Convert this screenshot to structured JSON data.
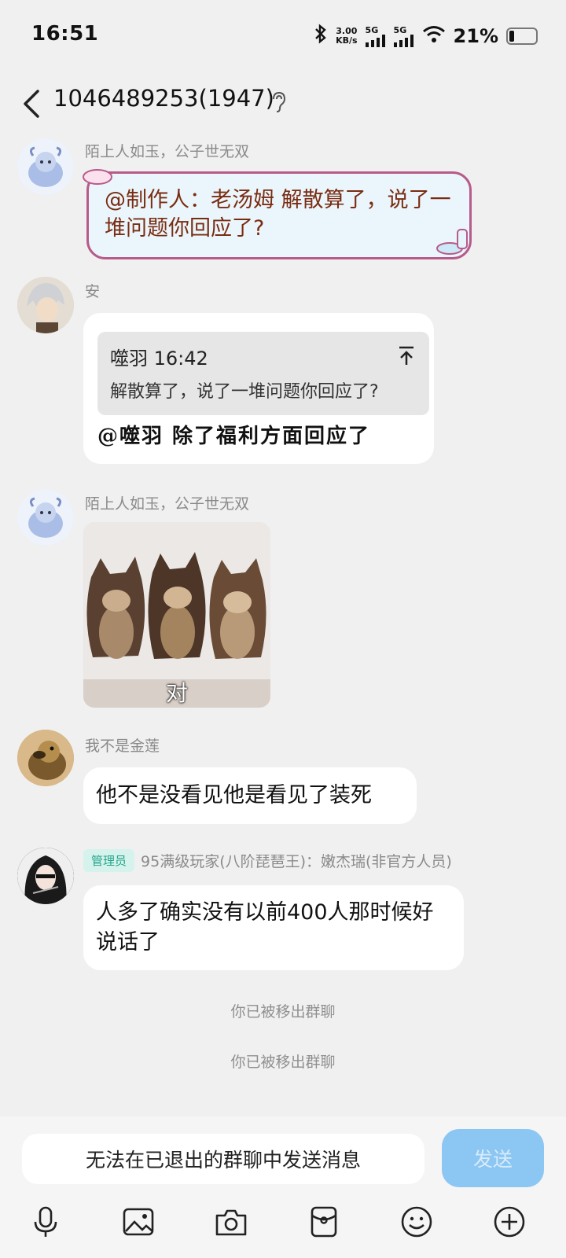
{
  "status": {
    "time": "16:51",
    "speed_value": "3.00",
    "speed_unit": "KB/s",
    "net1": "5G",
    "net2": "5G",
    "battery": "21%",
    "battery_level": 0.21
  },
  "header": {
    "title": "1046489253(1947)"
  },
  "messages": [
    {
      "sender": "陌上人如玉，公子世无双",
      "text": "@制作人：老汤姆 解散算了，说了一堆问题你回应了?"
    },
    {
      "sender": "安",
      "quote_author_time": "噬羽 16:42",
      "quote_text": "解散算了，说了一堆问题你回应了?",
      "text": "@噬羽 除了福利方面回应了"
    },
    {
      "sender": "陌上人如玉，公子世无双",
      "image_caption": "对"
    },
    {
      "sender": "我不是金莲",
      "text": "他不是没看见他是看见了装死"
    },
    {
      "badge": "管理员",
      "sender": "95满级玩家(八阶琵琶王)：嫩杰瑞(非官方人员)",
      "text": "人多了确实没有以前400人那时候好说话了"
    }
  ],
  "system_notices": [
    "你已被移出群聊",
    "你已被移出群聊"
  ],
  "input": {
    "placeholder": "无法在已退出的群聊中发送消息",
    "send_label": "发送"
  },
  "toolbar": {
    "icons": [
      "microphone-icon",
      "image-icon",
      "camera-icon",
      "red-packet-icon",
      "emoji-icon",
      "plus-icon"
    ]
  },
  "colors": {
    "background": "#f0f0f0",
    "send_button": "#8cc6f3",
    "admin_badge": "#21a58a",
    "special_bubble_border": "#b75b8a",
    "special_bubble_text": "#7a2c12"
  }
}
